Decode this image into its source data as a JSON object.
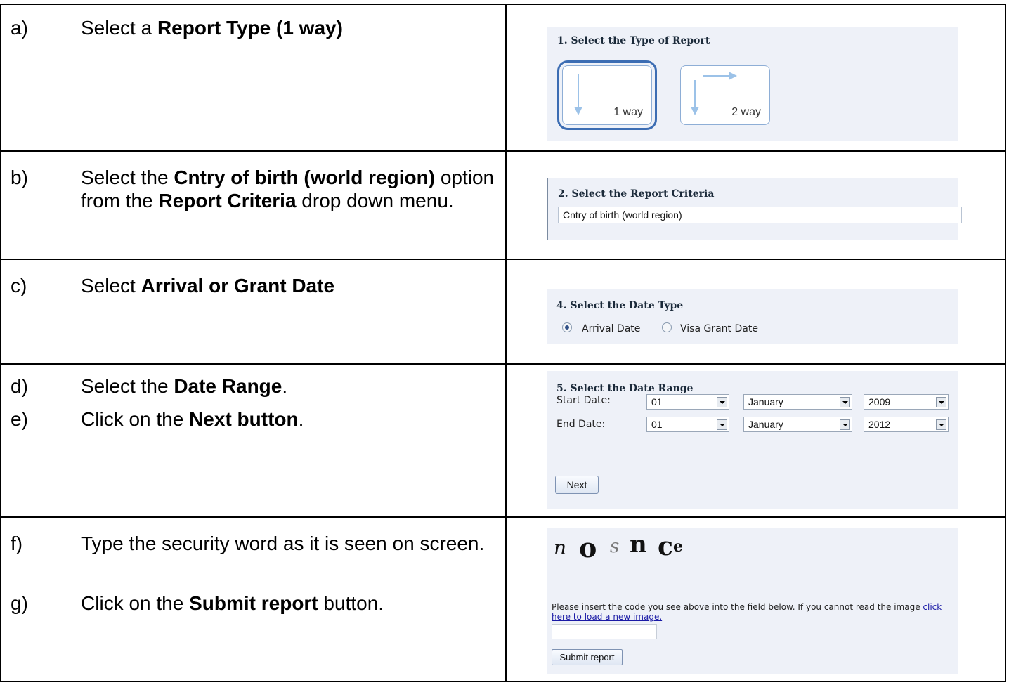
{
  "steps": [
    {
      "letter": "a)",
      "pre": "Select a ",
      "bold1": "Report Type (1 way)",
      "mid": "",
      "bold2": "",
      "post": ""
    },
    {
      "letter": "b)",
      "pre": "Select the ",
      "bold1": "Cntry of birth (world region)",
      "mid": " option from the ",
      "bold2": "Report Criteria",
      "post": " drop down menu."
    },
    {
      "letter": "c)",
      "pre": "Select ",
      "bold1": "Arrival or Grant Date",
      "mid": "",
      "bold2": "",
      "post": ""
    },
    {
      "letter": "d)",
      "pre": "Select the ",
      "bold1": "Date Range",
      "mid": "",
      "bold2": "",
      "post": "."
    },
    {
      "letter": "e)",
      "pre": "Click on the ",
      "bold1": "Next button",
      "mid": "",
      "bold2": "",
      "post": "."
    },
    {
      "letter": "f)",
      "pre": "Type the security word as it is seen on screen.",
      "bold1": "",
      "mid": "",
      "bold2": "",
      "post": ""
    },
    {
      "letter": "g)",
      "pre": "Click on the ",
      "bold1": "Submit report",
      "mid": "",
      "bold2": "",
      "post": " button."
    }
  ],
  "report_type": {
    "title": "1. Select the Type of Report",
    "option_1": "1 way",
    "option_2": "2 way",
    "selected": "1 way"
  },
  "criteria": {
    "title": "2. Select the Report Criteria",
    "value": "Cntry of birth (world region)"
  },
  "date_type": {
    "title": "4. Select the Date Type",
    "option_1": "Arrival Date",
    "option_2": "Visa Grant Date",
    "selected": "Arrival Date"
  },
  "date_range": {
    "title": "5. Select the Date Range",
    "start_label": "Start Date:",
    "end_label": "End Date:",
    "start": {
      "day": "01",
      "month": "January",
      "year": "2009"
    },
    "end": {
      "day": "01",
      "month": "January",
      "year": "2012"
    },
    "next_label": "Next"
  },
  "security": {
    "captcha_glyphs": [
      "n",
      "o",
      "s",
      "n",
      "c",
      "e"
    ],
    "help_text": "Please insert the code you see above into the field below. If you cannot read the image ",
    "help_link": "click here to load a new image.",
    "submit_label": "Submit report"
  }
}
